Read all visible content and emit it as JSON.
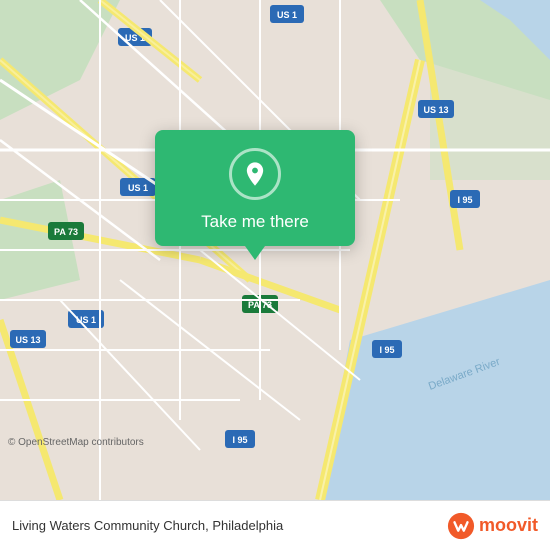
{
  "map": {
    "background_color": "#e8e0d8",
    "road_color_major": "#f5e97a",
    "road_color_highway": "#f5e97a",
    "road_color_minor": "#ffffff",
    "water_color": "#b0d0e8",
    "green_color": "#c8dfc0"
  },
  "popup": {
    "background_color": "#2eb872",
    "label": "Take me there",
    "icon": "location-pin"
  },
  "footer": {
    "location_text": "Living Waters Community Church, Philadelphia",
    "osm_credit": "© OpenStreetMap contributors",
    "brand_name": "moovit"
  }
}
